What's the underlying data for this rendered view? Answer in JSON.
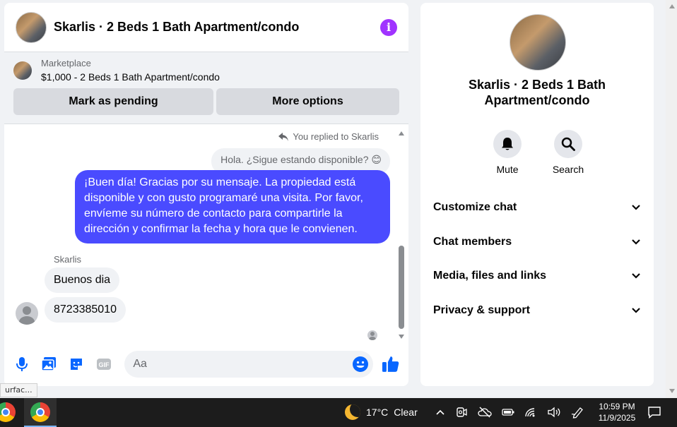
{
  "chat": {
    "title": "Skarlis · 2 Beds 1 Bath Apartment/condo",
    "info_icon": "i",
    "marketplace": {
      "label": "Marketplace",
      "listing": "$1,000 - 2 Beds 1 Bath Apartment/condo",
      "mark_pending": "Mark as pending",
      "more_options": "More options"
    },
    "replied_label": "You replied to Skarlis",
    "quoted_message": "Hola. ¿Sigue estando disponible? 😊",
    "outgoing_message": "¡Buen día! Gracias por su mensaje. La propiedad está disponible y con gusto programaré una visita. Por favor, envíeme su número de contacto para compartirle la dirección y confirmar la fecha y hora que le convienen.",
    "sender_name": "Skarlis",
    "incoming": [
      "Buenos dia",
      "8723385010"
    ],
    "composer": {
      "placeholder": "Aa",
      "gif_label": "GIF"
    }
  },
  "side": {
    "title": "Skarlis · 2 Beds 1 Bath Apartment/condo",
    "actions": [
      {
        "label": "Mute",
        "icon": "bell-icon"
      },
      {
        "label": "Search",
        "icon": "search-icon"
      }
    ],
    "sections": [
      "Customize chat",
      "Chat members",
      "Media, files and links",
      "Privacy & support"
    ]
  },
  "tooltip": "urfac...",
  "taskbar": {
    "temperature": "17°C",
    "weather": "Clear",
    "time": "10:59 PM",
    "date": "11/9/2025"
  },
  "colors": {
    "accent": "#4a4bff",
    "info": "#a033ff",
    "messenger_blue": "#0866ff"
  }
}
